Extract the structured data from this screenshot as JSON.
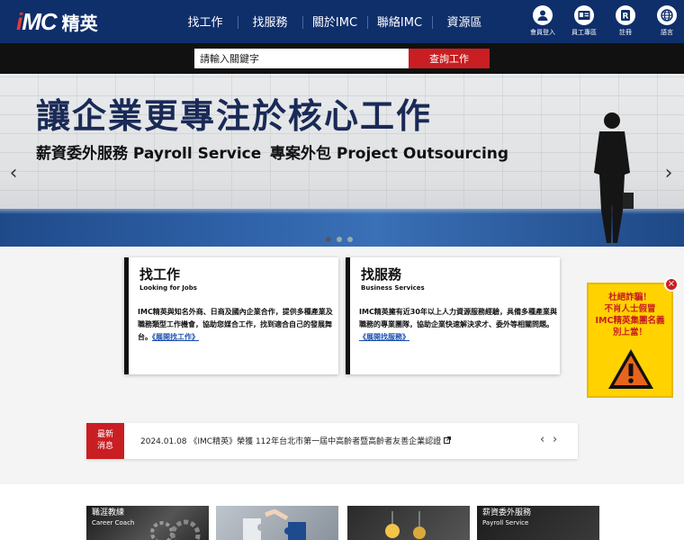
{
  "header": {
    "logo_mark": "IMC",
    "logo_text": "精英",
    "nav": [
      "找工作",
      "找服務",
      "關於IMC",
      "聯絡IMC",
      "資源區"
    ],
    "tools": [
      {
        "label": "會員登入",
        "icon": "user-icon"
      },
      {
        "label": "員工專區",
        "icon": "id-card-icon"
      },
      {
        "label": "註冊",
        "icon": "register-icon"
      },
      {
        "label": "語言",
        "icon": "globe-icon"
      }
    ]
  },
  "search": {
    "placeholder": "請輸入關鍵字",
    "button": "查詢工作"
  },
  "banner": {
    "title": "讓企業更專注於核心工作",
    "sub1": "薪資委外服務 Payroll Service",
    "sub2": "專案外包 Project Outsourcing",
    "prev": "‹",
    "next": "›"
  },
  "cards": [
    {
      "title": "找工作",
      "subtitle": "Looking for Jobs",
      "text": "IMC精英與知名外商、日商及國內企業合作，提供多種產業及職務類型工作機會，協助您媒合工作，找到適合自己的發展舞台。",
      "link": "《展開找工作》"
    },
    {
      "title": "找服務",
      "subtitle": "Business Services",
      "text": "IMC精英擁有近30年以上人力資源服務經驗，具備多種產業與職務的專業團隊，協助企業快速解決求才、委外等相關問題。",
      "link": "《展開找服務》"
    }
  ],
  "news": {
    "tag_line1": "最新",
    "tag_line2": "消息",
    "item": "2024.01.08 《IMC精英》榮獲 112年台北市第一屆中高齡者暨高齡者友善企業認證",
    "prev": "‹",
    "next": "›"
  },
  "popup": {
    "line1": "杜絕詐騙！",
    "line2": "不肖人士假冒",
    "line3": "IMC精英集團名義",
    "line4": "別上當！",
    "close": "×"
  },
  "tiles": [
    {
      "label": "職涯教練",
      "en": "Career Coach"
    },
    {
      "label": "",
      "en": ""
    },
    {
      "label": "",
      "en": ""
    },
    {
      "label": "",
      "en": ""
    },
    {
      "label": "薪資委外服務",
      "en": "Payroll Service"
    }
  ],
  "colors": {
    "header_bg": "#0f2f6b",
    "accent_red": "#c91e22",
    "popup_yellow": "#ffd200",
    "link_blue": "#1a4fae"
  }
}
